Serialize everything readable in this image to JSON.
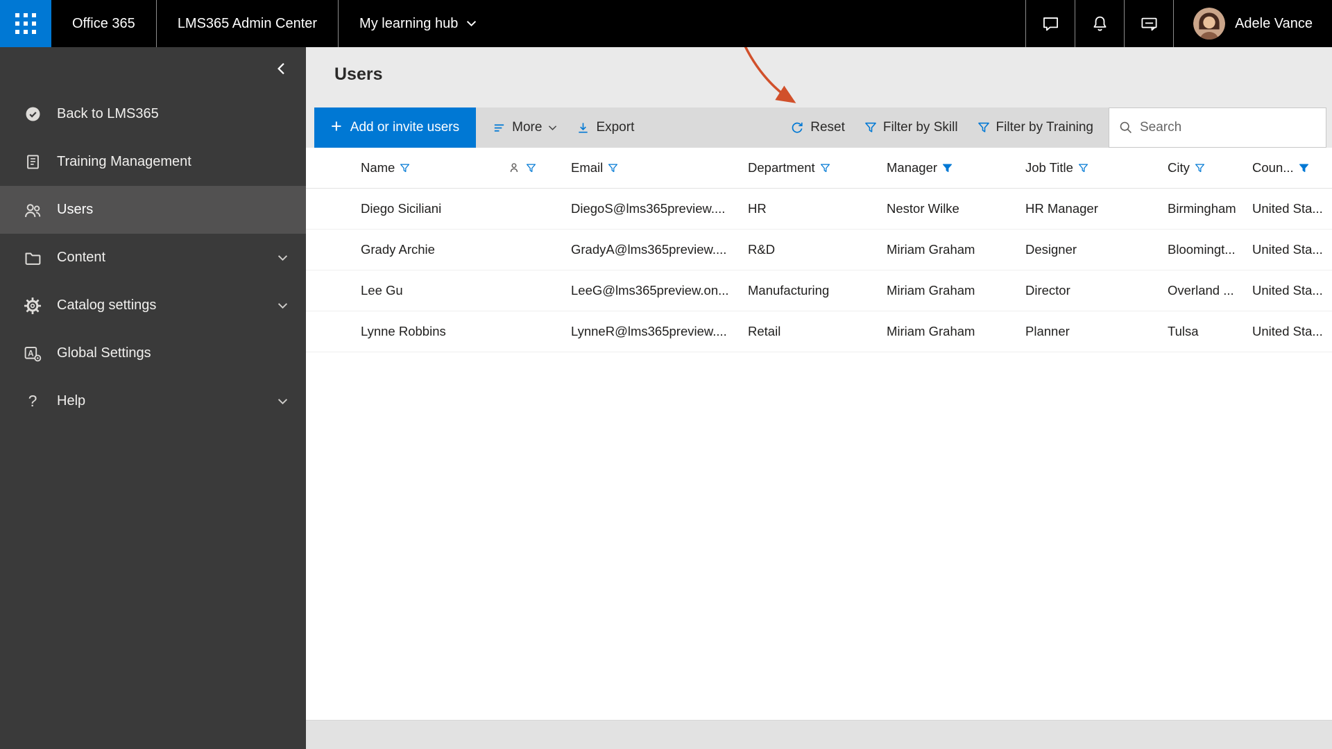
{
  "colors": {
    "accent": "#0078d4",
    "topbar_bg": "#000000",
    "sidebar_bg": "#3a3a3a",
    "sidebar_selected_bg": "#525151",
    "annotation_arrow": "#d1502b"
  },
  "icons": [
    "waffle-icon",
    "chevron-down-icon",
    "chat-icon",
    "bell-icon",
    "feedback-icon",
    "check-circle-icon",
    "training-icon",
    "users-icon",
    "folder-icon",
    "gear-icon",
    "global-settings-icon",
    "help-icon",
    "chevron-left-icon",
    "plus-icon",
    "more-lines-icon",
    "export-icon",
    "refresh-icon",
    "funnel-icon",
    "person-icon",
    "search-icon",
    "annotation-arrow"
  ],
  "topbar": {
    "brand": "Office 365",
    "admin_center": "LMS365 Admin Center",
    "hub": "My learning hub",
    "user": "Adele Vance"
  },
  "sidebar": {
    "items": [
      {
        "label": "Back to LMS365",
        "icon": "check-circle-icon",
        "selected": false,
        "expandable": false
      },
      {
        "label": "Training Management",
        "icon": "training-icon",
        "selected": false,
        "expandable": false
      },
      {
        "label": "Users",
        "icon": "users-icon",
        "selected": true,
        "expandable": false
      },
      {
        "label": "Content",
        "icon": "folder-icon",
        "selected": false,
        "expandable": true
      },
      {
        "label": "Catalog settings",
        "icon": "gear-icon",
        "selected": false,
        "expandable": true
      },
      {
        "label": "Global Settings",
        "icon": "global-settings-icon",
        "selected": false,
        "expandable": false
      },
      {
        "label": "Help",
        "icon": "help-icon",
        "selected": false,
        "expandable": true
      }
    ]
  },
  "page": {
    "title": "Users",
    "toolbar": {
      "add_button": "Add or invite users",
      "more": "More",
      "export": "Export",
      "reset": "Reset",
      "filter_by_skill": "Filter by Skill",
      "filter_by_training": "Filter by Training",
      "search_placeholder": "Search"
    },
    "table": {
      "columns": [
        {
          "label": "Name",
          "filter": "outline"
        },
        {
          "label": "",
          "filter": "outline",
          "icon": "person-icon"
        },
        {
          "label": "Email",
          "filter": "outline"
        },
        {
          "label": "Department",
          "filter": "outline"
        },
        {
          "label": "Manager",
          "filter": "filled"
        },
        {
          "label": "Job Title",
          "filter": "outline"
        },
        {
          "label": "City",
          "filter": "outline"
        },
        {
          "label": "Coun...",
          "filter": "filled"
        }
      ],
      "rows": [
        {
          "name": "Diego Siciliani",
          "email": "DiegoS@lms365preview....",
          "department": "HR",
          "manager": "Nestor Wilke",
          "job_title": "HR Manager",
          "city": "Birmingham",
          "country": "United Sta..."
        },
        {
          "name": "Grady Archie",
          "email": "GradyA@lms365preview....",
          "department": "R&D",
          "manager": "Miriam Graham",
          "job_title": "Designer",
          "city": "Bloomingt...",
          "country": "United Sta..."
        },
        {
          "name": "Lee Gu",
          "email": "LeeG@lms365preview.on...",
          "department": "Manufacturing",
          "manager": "Miriam Graham",
          "job_title": "Director",
          "city": "Overland ...",
          "country": "United Sta..."
        },
        {
          "name": "Lynne Robbins",
          "email": "LynneR@lms365preview....",
          "department": "Retail",
          "manager": "Miriam Graham",
          "job_title": "Planner",
          "city": "Tulsa",
          "country": "United Sta..."
        }
      ]
    }
  }
}
